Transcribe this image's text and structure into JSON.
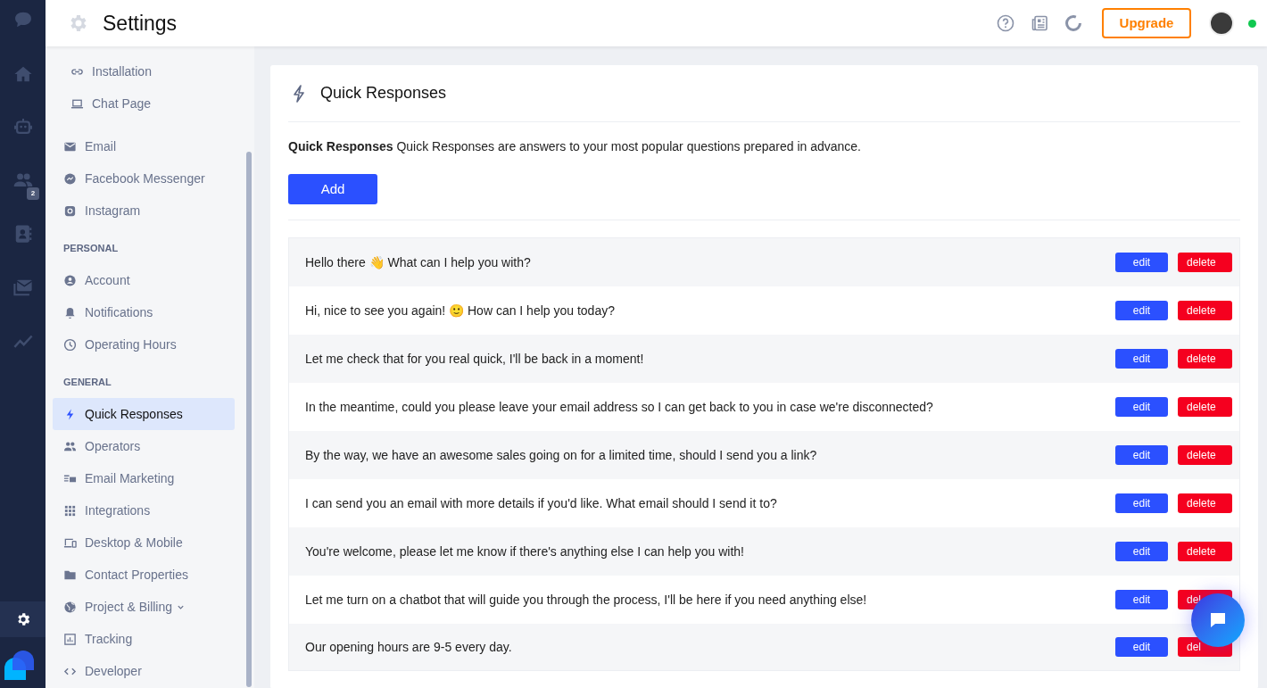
{
  "header": {
    "title": "Settings",
    "upgrade_button": "Upgrade",
    "online": true
  },
  "rail": {
    "badge": "2"
  },
  "sidebar": {
    "sections": [
      {
        "items": [
          {
            "label": "Installation",
            "selected": false
          },
          {
            "label": "Chat Page",
            "selected": false
          }
        ]
      },
      {
        "items": [
          {
            "label": "Email",
            "selected": false
          },
          {
            "label": "Facebook Messenger",
            "selected": false
          },
          {
            "label": "Instagram",
            "selected": false
          }
        ]
      },
      {
        "heading": "PERSONAL",
        "items": [
          {
            "label": "Account",
            "selected": false
          },
          {
            "label": "Notifications",
            "selected": false
          },
          {
            "label": "Operating Hours",
            "selected": false
          }
        ]
      },
      {
        "heading": "GENERAL",
        "items": [
          {
            "label": "Quick Responses",
            "selected": true
          },
          {
            "label": "Operators",
            "selected": false
          },
          {
            "label": "Email Marketing",
            "selected": false
          },
          {
            "label": "Integrations",
            "selected": false
          },
          {
            "label": "Desktop & Mobile",
            "selected": false
          },
          {
            "label": "Contact Properties",
            "selected": false
          },
          {
            "label": "Project & Billing",
            "selected": false,
            "expandable": true
          },
          {
            "label": "Tracking",
            "selected": false
          },
          {
            "label": "Developer",
            "selected": false
          }
        ]
      }
    ]
  },
  "panel": {
    "title": "Quick Responses",
    "description": "**Quick Responses** Quick Responses are answers to your most popular questions prepared in advance.",
    "add_button": "Add",
    "responses": [
      {
        "text": "Hello there 👋 What can I help you with?",
        "edit": "edit",
        "delete": "delete"
      },
      {
        "text": "Hi, nice to see you again! 🙂 How can I help you today?",
        "edit": "edit",
        "delete": "delete"
      },
      {
        "text": "Let me check that for you real quick, I'll be back in a moment!",
        "edit": "edit",
        "delete": "delete"
      },
      {
        "text": "In the meantime, could you please leave your email address so I can get back to you in case we're disconnected?",
        "edit": "edit",
        "delete": "delete"
      },
      {
        "text": "By the way, we have an awesome sales going on for a limited time, should I send you a link?",
        "edit": "edit",
        "delete": "delete"
      },
      {
        "text": "I can send you an email with more details if you'd like. What email should I send it to?",
        "edit": "edit",
        "delete": "delete"
      },
      {
        "text": "You're welcome, please let me know if there's anything else I can help you with!",
        "edit": "edit",
        "delete": "delete"
      },
      {
        "text": "Let me turn on a chatbot that will guide you through the process, I'll be here if you need anything else!",
        "edit": "edit",
        "delete": "del"
      },
      {
        "text": "Our opening hours are 9-5 every day.",
        "edit": "edit",
        "delete": "del"
      }
    ]
  }
}
